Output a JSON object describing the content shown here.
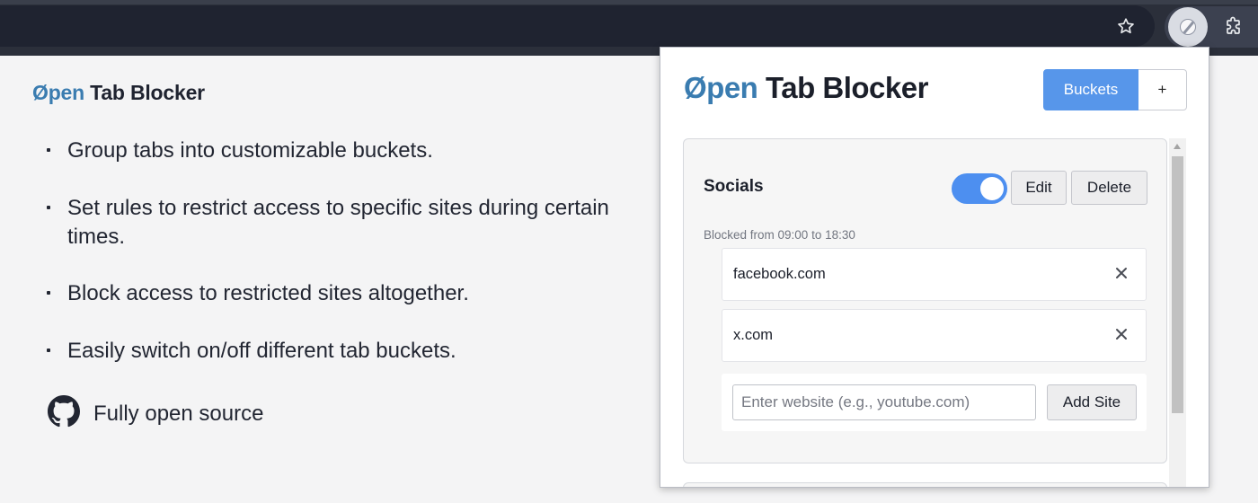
{
  "browser": {
    "bookmark_icon": "star-icon",
    "extension_icon": "tab-blocker-extension-icon",
    "extensions_icon": "puzzle-icon"
  },
  "landing": {
    "title_brand": "Øpen",
    "title_rest": " Tab Blocker",
    "features": [
      "Group tabs into customizable buckets.",
      "Set rules to restrict access to specific sites during certain times.",
      "Block access to restricted sites altogether.",
      "Easily switch on/off different tab buckets."
    ],
    "open_source_label": "Fully open source",
    "open_source_icon": "github-icon"
  },
  "popup": {
    "title_brand": "Øpen",
    "title_rest": " Tab Blocker",
    "buckets_tab": "Buckets",
    "add_tab": "+",
    "bucket": {
      "name": "Socials",
      "enabled": true,
      "edit_label": "Edit",
      "delete_label": "Delete",
      "schedule": "Blocked from 09:00 to 18:30",
      "sites": [
        "facebook.com",
        "x.com"
      ],
      "input_placeholder": "Enter website (e.g., youtube.com)",
      "input_value": "",
      "add_label": "Add Site"
    }
  },
  "colors": {
    "brand_blue": "#3a7cb0",
    "accent": "#5796ea",
    "toggle_on": "#4d8ff0",
    "toolbar": "#2b2f3a"
  }
}
